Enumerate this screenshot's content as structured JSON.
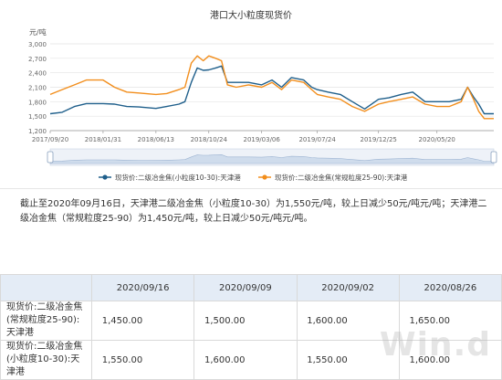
{
  "chart_data": {
    "type": "line",
    "title": "港口大小粒度现货价",
    "ylabel": "元/吨",
    "ylim": [
      1200,
      3000
    ],
    "yticks": [
      "3,000",
      "2,700",
      "2,400",
      "2,100",
      "1,800",
      "1,500",
      "1,200"
    ],
    "xticks": [
      "2017/09/20",
      "2018/01/31",
      "2018/06/13",
      "2018/10/24",
      "2019/03/06",
      "2019/07/24",
      "2019/12/25",
      "2020/05/20"
    ],
    "grid": true,
    "legend_position": "bottom",
    "series": [
      {
        "name": "现货价:二级冶金焦(小粒度10-30):天津港",
        "color": "#1f5f8b",
        "points": [
          [
            "2017/09/20",
            1550
          ],
          [
            "2017/10/20",
            1580
          ],
          [
            "2017/11/20",
            1700
          ],
          [
            "2017/12/20",
            1760
          ],
          [
            "2018/01/31",
            1760
          ],
          [
            "2018/03/01",
            1750
          ],
          [
            "2018/04/01",
            1700
          ],
          [
            "2018/05/01",
            1690
          ],
          [
            "2018/06/13",
            1660
          ],
          [
            "2018/07/10",
            1700
          ],
          [
            "2018/08/10",
            1750
          ],
          [
            "2018/08/25",
            1800
          ],
          [
            "2018/09/10",
            2200
          ],
          [
            "2018/09/25",
            2500
          ],
          [
            "2018/10/10",
            2450
          ],
          [
            "2018/10/24",
            2460
          ],
          [
            "2018/11/10",
            2500
          ],
          [
            "2018/11/25",
            2540
          ],
          [
            "2018/12/10",
            2200
          ],
          [
            "2019/01/01",
            2200
          ],
          [
            "2019/02/01",
            2200
          ],
          [
            "2019/03/06",
            2150
          ],
          [
            "2019/04/01",
            2250
          ],
          [
            "2019/04/25",
            2100
          ],
          [
            "2019/05/20",
            2300
          ],
          [
            "2019/06/20",
            2250
          ],
          [
            "2019/07/10",
            2100
          ],
          [
            "2019/07/24",
            2050
          ],
          [
            "2019/08/20",
            2000
          ],
          [
            "2019/09/20",
            1950
          ],
          [
            "2019/10/20",
            1800
          ],
          [
            "2019/11/20",
            1650
          ],
          [
            "2019/12/25",
            1850
          ],
          [
            "2020/01/20",
            1880
          ],
          [
            "2020/02/20",
            1950
          ],
          [
            "2020/03/20",
            2000
          ],
          [
            "2020/04/20",
            1800
          ],
          [
            "2020/05/20",
            1800
          ],
          [
            "2020/06/20",
            1800
          ],
          [
            "2020/07/20",
            1850
          ],
          [
            "2020/08/05",
            2100
          ],
          [
            "2020/08/20",
            1900
          ],
          [
            "2020/09/02",
            1750
          ],
          [
            "2020/09/16",
            1550
          ],
          [
            "2020/10/10",
            1550
          ]
        ]
      },
      {
        "name": "现货价:二级冶金焦(常规粒度25-90):天津港",
        "color": "#f28e1c",
        "points": [
          [
            "2017/09/20",
            1950
          ],
          [
            "2017/10/20",
            2050
          ],
          [
            "2017/11/20",
            2150
          ],
          [
            "2017/12/20",
            2250
          ],
          [
            "2018/01/31",
            2250
          ],
          [
            "2018/03/01",
            2100
          ],
          [
            "2018/04/01",
            2000
          ],
          [
            "2018/05/01",
            1980
          ],
          [
            "2018/06/13",
            1950
          ],
          [
            "2018/07/10",
            1970
          ],
          [
            "2018/08/10",
            2050
          ],
          [
            "2018/08/25",
            2100
          ],
          [
            "2018/09/10",
            2600
          ],
          [
            "2018/09/25",
            2750
          ],
          [
            "2018/10/10",
            2650
          ],
          [
            "2018/10/24",
            2750
          ],
          [
            "2018/11/10",
            2700
          ],
          [
            "2018/11/25",
            2650
          ],
          [
            "2018/12/10",
            2150
          ],
          [
            "2019/01/01",
            2100
          ],
          [
            "2019/02/01",
            2150
          ],
          [
            "2019/03/06",
            2100
          ],
          [
            "2019/04/01",
            2200
          ],
          [
            "2019/04/25",
            2050
          ],
          [
            "2019/05/20",
            2250
          ],
          [
            "2019/06/20",
            2200
          ],
          [
            "2019/07/10",
            2050
          ],
          [
            "2019/07/24",
            1950
          ],
          [
            "2019/08/20",
            1900
          ],
          [
            "2019/09/20",
            1850
          ],
          [
            "2019/10/20",
            1700
          ],
          [
            "2019/11/20",
            1600
          ],
          [
            "2019/12/25",
            1750
          ],
          [
            "2020/01/20",
            1800
          ],
          [
            "2020/02/20",
            1850
          ],
          [
            "2020/03/20",
            1900
          ],
          [
            "2020/04/20",
            1750
          ],
          [
            "2020/05/20",
            1700
          ],
          [
            "2020/06/20",
            1700
          ],
          [
            "2020/07/20",
            1800
          ],
          [
            "2020/08/05",
            2100
          ],
          [
            "2020/08/20",
            1850
          ],
          [
            "2020/09/02",
            1600
          ],
          [
            "2020/09/16",
            1450
          ],
          [
            "2020/10/10",
            1450
          ]
        ]
      }
    ]
  },
  "summary": "截止至2020年09月16日，天津港二级冶金焦（小粒度10-30）为1,550元/吨，较上日减少50元/吨元/吨；天津港二级冶金焦（常规粒度25-90）为1,450元/吨，较上日减少50元/吨元/吨。",
  "table": {
    "headers": [
      "",
      "2020/09/16",
      "2020/09/09",
      "2020/09/02",
      "2020/08/26"
    ],
    "rows": [
      {
        "label": "现货价:二级冶金焦(常规粒度25-90):天津港",
        "values": [
          "1,450.00",
          "1,500.00",
          "1,600.00",
          "1,650.00"
        ]
      },
      {
        "label": "现货价:二级冶金焦(小粒度10-30):天津港",
        "values": [
          "1,550.00",
          "1,600.00",
          "1,550.00",
          "1,600.00"
        ]
      }
    ]
  },
  "watermark": "Win.d"
}
